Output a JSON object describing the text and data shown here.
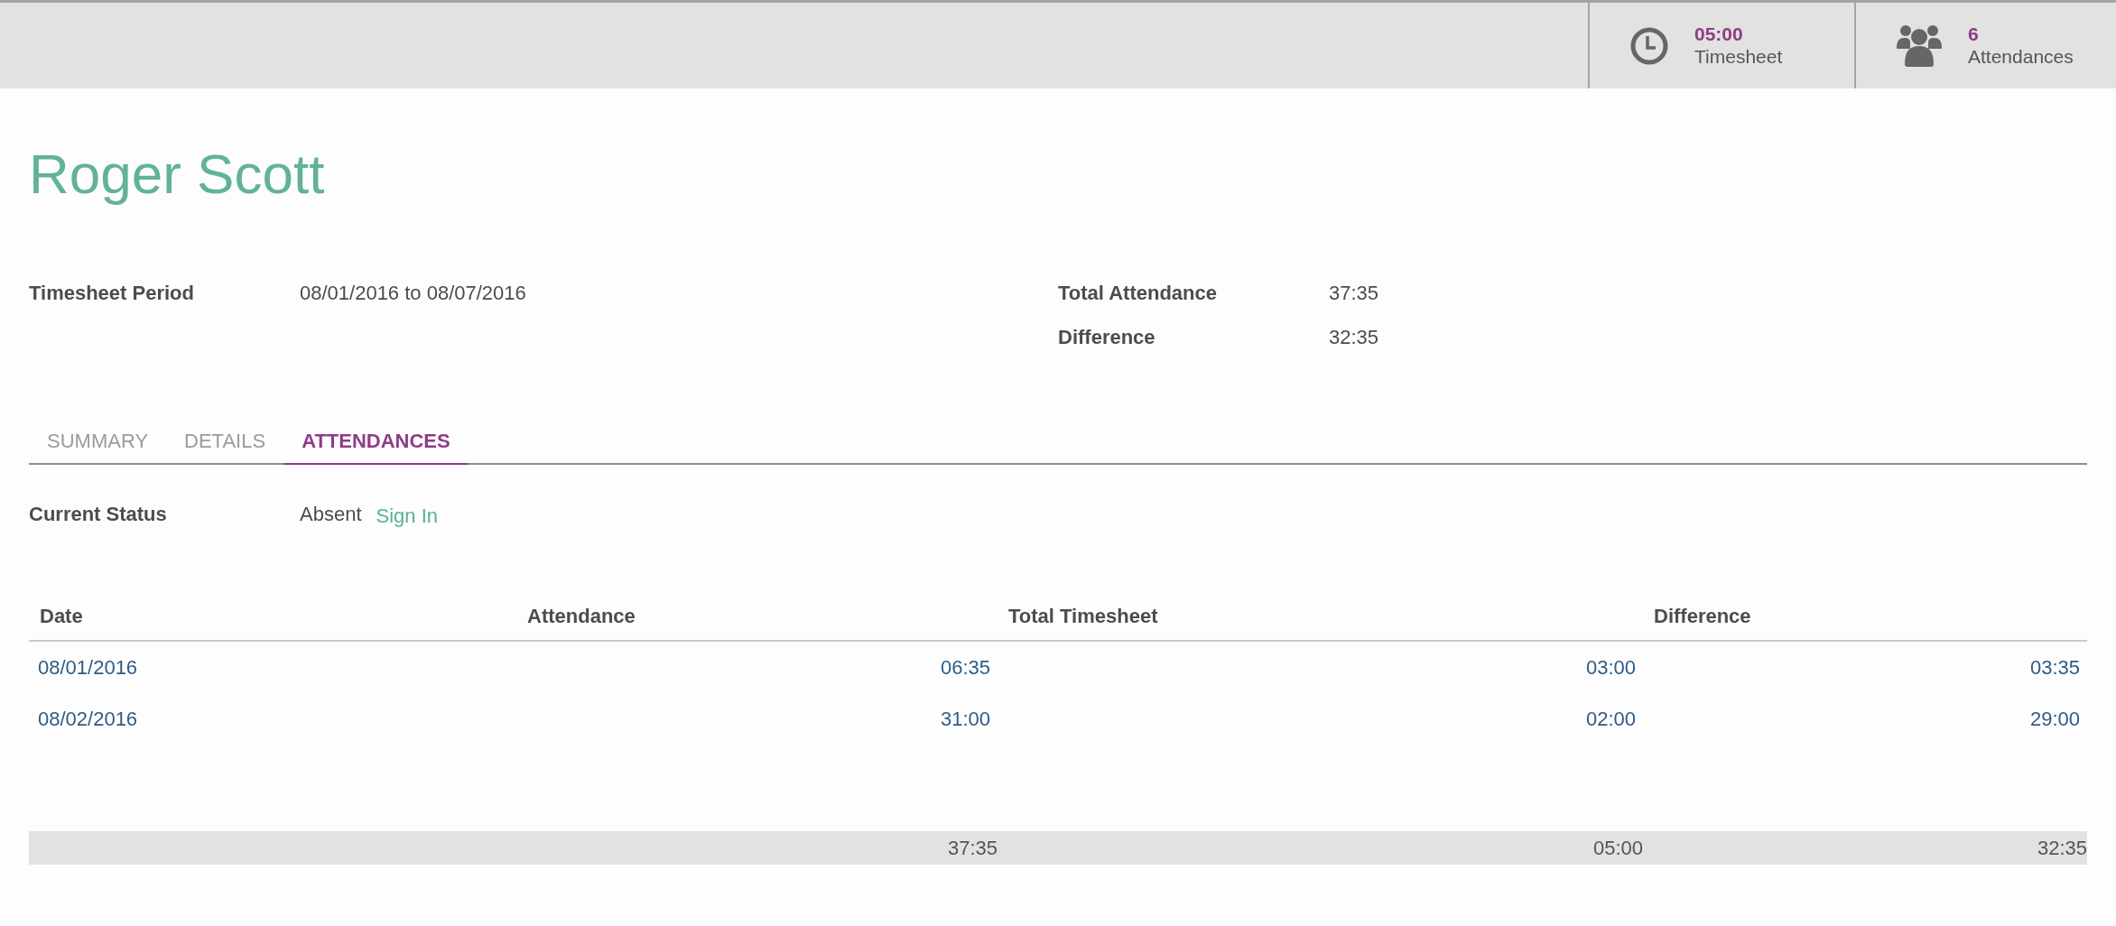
{
  "stat_buttons": [
    {
      "kind": "clock",
      "value": "05:00",
      "label": "Timesheet"
    },
    {
      "kind": "people",
      "value": "6",
      "label": "Attendances"
    }
  ],
  "title": "Roger Scott",
  "fields_left": [
    {
      "label": "Timesheet Period",
      "value": "08/01/2016 to 08/07/2016"
    }
  ],
  "fields_right": [
    {
      "label": "Total Attendance",
      "value": "37:35"
    },
    {
      "label": "Difference",
      "value": "32:35"
    }
  ],
  "tabs": [
    {
      "label": "SUMMARY",
      "selected": false
    },
    {
      "label": "DETAILS",
      "selected": false
    },
    {
      "label": "ATTENDANCES",
      "selected": true
    }
  ],
  "current_status": {
    "label": "Current Status",
    "value": "Absent",
    "action": "Sign In"
  },
  "table": {
    "columns": [
      "Date",
      "Attendance",
      "Total Timesheet",
      "Difference"
    ],
    "rows": [
      [
        "08/01/2016",
        "06:35",
        "03:00",
        "03:35"
      ],
      [
        "08/02/2016",
        "31:00",
        "02:00",
        "29:00"
      ]
    ],
    "totals": [
      "37:35",
      "05:00",
      "32:35"
    ]
  }
}
